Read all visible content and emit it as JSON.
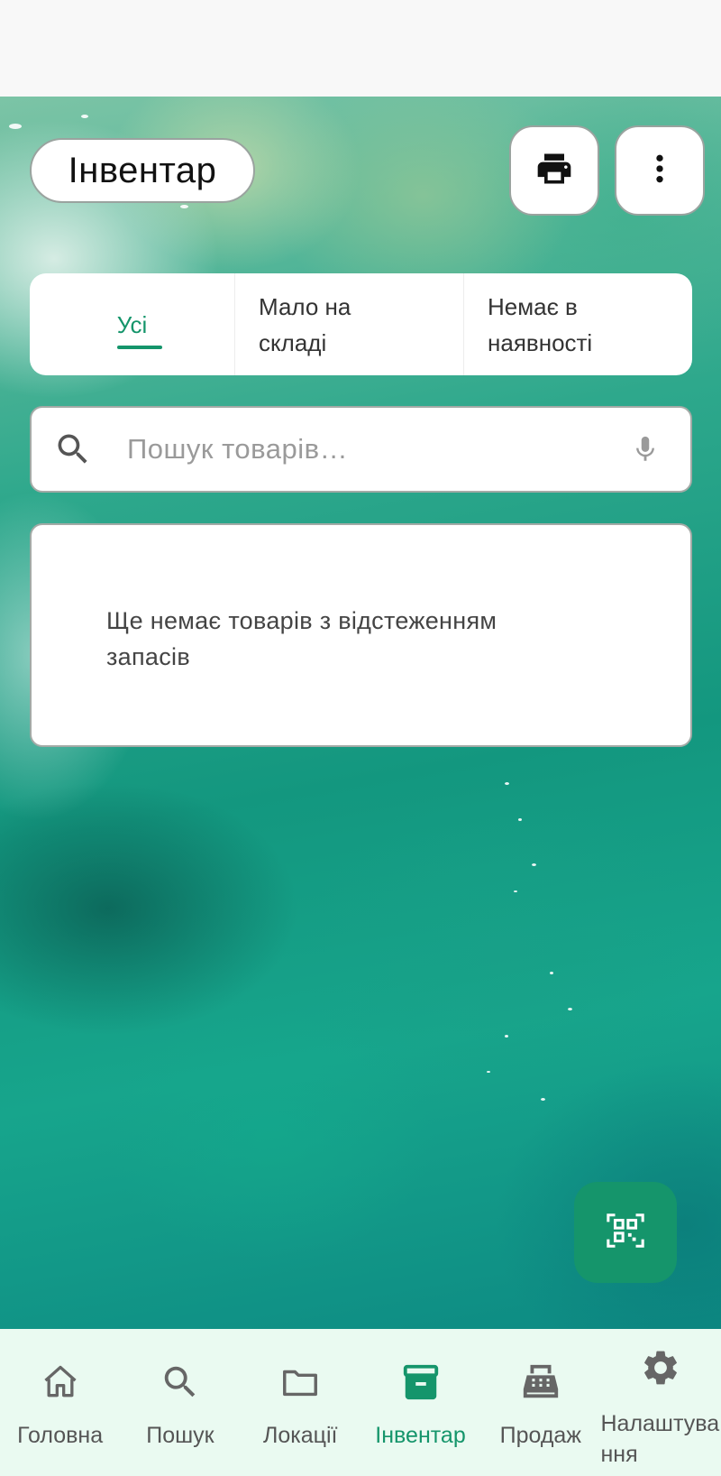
{
  "header": {
    "title": "Інвентар"
  },
  "toolbar": {
    "print_icon": "print-icon",
    "more_icon": "more-vert-icon"
  },
  "tabs": [
    {
      "label": "Усі",
      "active": true
    },
    {
      "label": "Мало на складі",
      "active": false
    },
    {
      "label": "Немає в наявності",
      "active": false
    }
  ],
  "search": {
    "placeholder": "Пошук товарів…",
    "value": ""
  },
  "empty_state": {
    "message": "Ще немає товарів з відстеженням запасів"
  },
  "fab": {
    "icon": "qr-scan-icon"
  },
  "bottom_nav": {
    "items": [
      {
        "label": "Головна",
        "icon": "home-icon",
        "active": false
      },
      {
        "label": "Пошук",
        "icon": "search-icon",
        "active": false
      },
      {
        "label": "Локації",
        "icon": "folder-icon",
        "active": false
      },
      {
        "label": "Інвентар",
        "icon": "inventory-box-icon",
        "active": true
      },
      {
        "label": "Продаж",
        "icon": "cash-register-icon",
        "active": false
      },
      {
        "label": "Налаштування",
        "icon": "gear-icon",
        "active": false
      }
    ]
  },
  "colors": {
    "accent": "#15956b",
    "nav_background": "#eafaf1",
    "icon_gray": "#666666"
  }
}
